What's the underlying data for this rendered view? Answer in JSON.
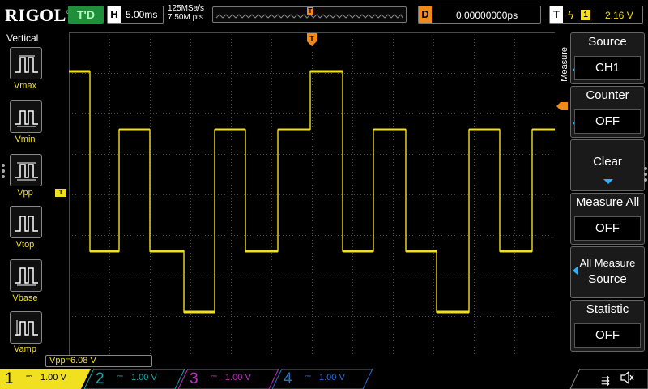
{
  "topbar": {
    "logo": "RIGOL",
    "trigger_status": "T'D",
    "horizontal_key": "H",
    "timebase": "5.00ms",
    "sample_rate": "125MSa/s",
    "memory_depth": "7.50M pts",
    "delay_key": "D",
    "delay_value": "0.00000000ps",
    "trigger_key": "T",
    "trigger_source": "1",
    "trigger_level": "2.16 V"
  },
  "left_menu": {
    "title": "Vertical",
    "items": [
      {
        "label": "Vmax"
      },
      {
        "label": "Vmin"
      },
      {
        "label": "Vpp"
      },
      {
        "label": "Vtop"
      },
      {
        "label": "Vbase"
      },
      {
        "label": "Vamp"
      }
    ]
  },
  "right_menu": {
    "vertical_title": "Measure",
    "source_title": "Source",
    "source_value": "CH1",
    "counter_title": "Counter",
    "counter_value": "OFF",
    "clear_label": "Clear",
    "measure_all_title": "Measure All",
    "measure_all_value": "OFF",
    "all_measure_source_line1": "All Measure",
    "all_measure_source_line2": "Source",
    "statistic_title": "Statistic",
    "statistic_value": "OFF"
  },
  "waveform": {
    "channel_marker": "1",
    "trigger_marker": "T",
    "color": "#f0e020"
  },
  "measurement": {
    "vpp_readout": "Vpp=6.08 V"
  },
  "channels": [
    {
      "num": "1",
      "scale": "1.00 V",
      "active": true,
      "color": "#f0e020"
    },
    {
      "num": "2",
      "scale": "1.00 V",
      "active": false,
      "color": "#1aa7a7"
    },
    {
      "num": "3",
      "scale": "1.00 V",
      "active": false,
      "color": "#c030c0"
    },
    {
      "num": "4",
      "scale": "1.00 V",
      "active": false,
      "color": "#2a6fd8"
    }
  ],
  "colors": {
    "ch1": "#f0e020",
    "trigger": "#f08a1a",
    "menu_accent": "#2ab4ff",
    "grid": "#4a4a4a"
  }
}
